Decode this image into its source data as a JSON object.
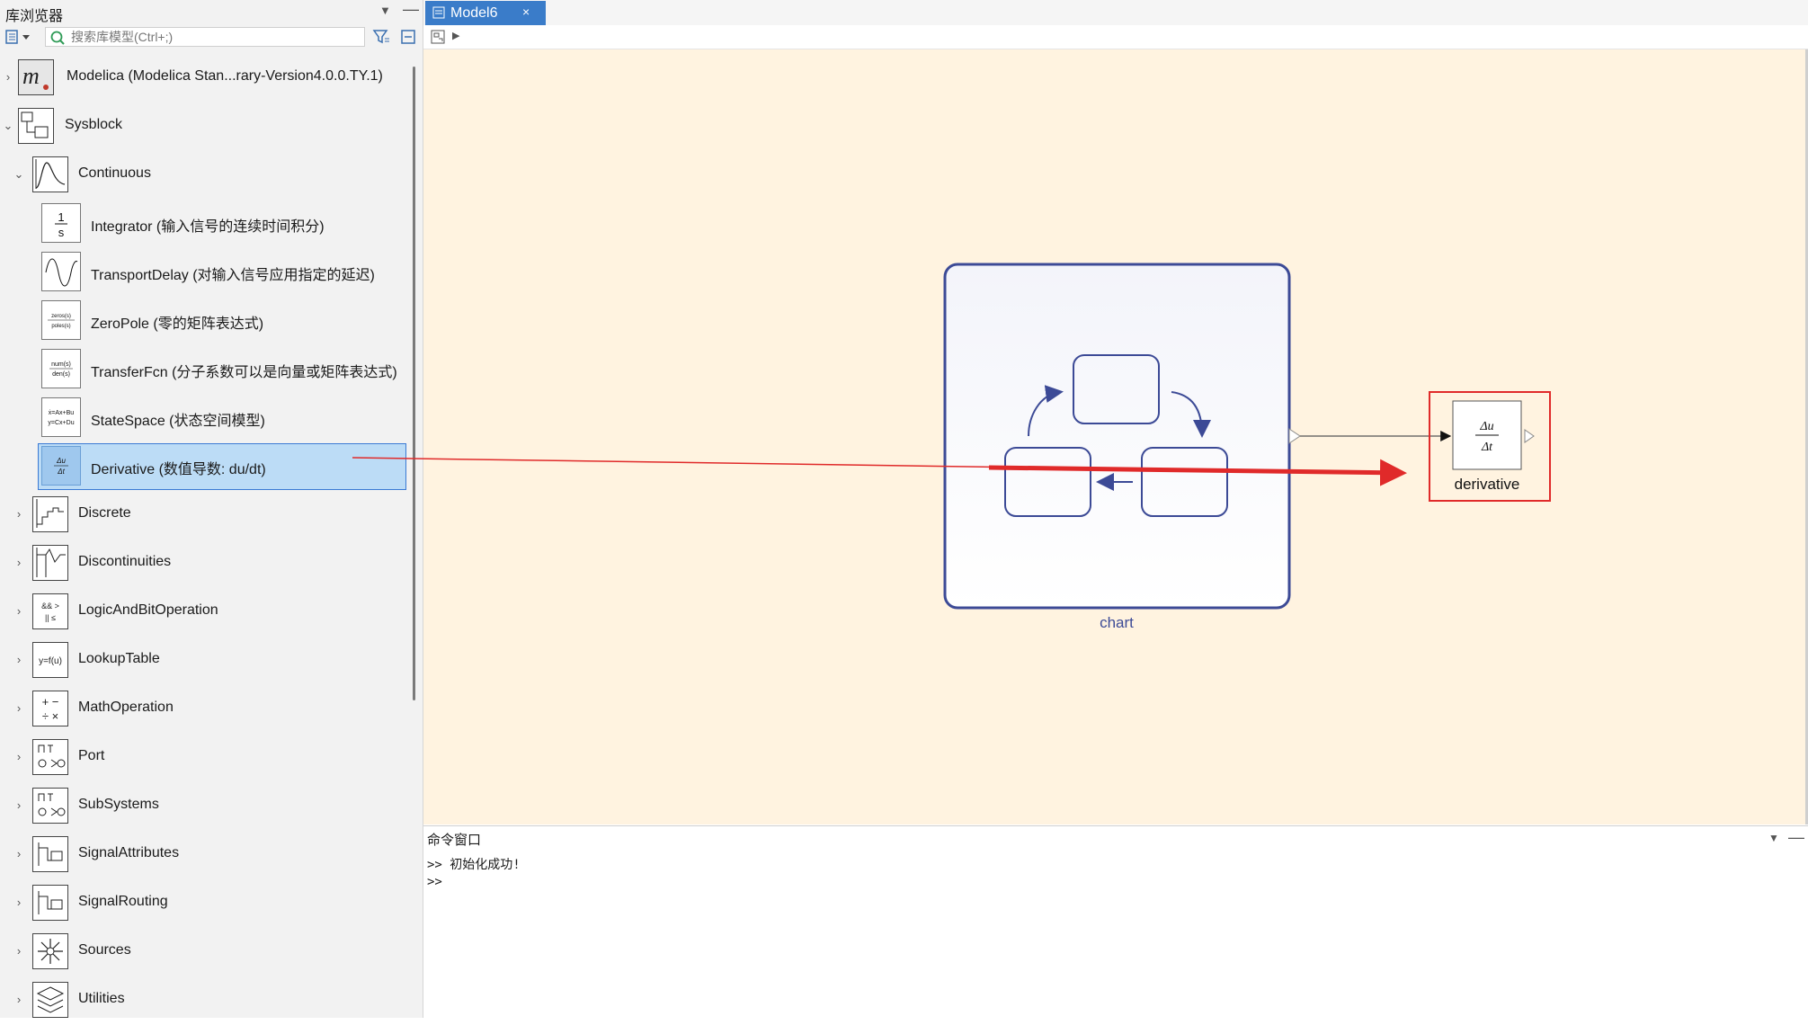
{
  "library_browser": {
    "title": "库浏览器",
    "search_placeholder": "搜索库模型(Ctrl+;)",
    "items": [
      {
        "label": "Modelica (Modelica Stan...rary-Version4.0.0.TY.1)",
        "expanded": false,
        "level": 0,
        "icon": "modelica-logo-icon"
      },
      {
        "label": "Sysblock",
        "expanded": true,
        "level": 0,
        "icon": "sysblock-icon"
      },
      {
        "label": "Continuous",
        "expanded": true,
        "level": 1,
        "icon": "continuous-icon"
      },
      {
        "label": "Integrator (输入信号的连续时间积分)",
        "level": 2,
        "icon": "integrator-icon"
      },
      {
        "label": "TransportDelay (对输入信号应用指定的延迟)",
        "level": 2,
        "icon": "transport-delay-icon"
      },
      {
        "label": "ZeroPole (零的矩阵表达式)",
        "level": 2,
        "icon": "zero-pole-icon"
      },
      {
        "label": "TransferFcn (分子系数可以是向量或矩阵表达式)",
        "level": 2,
        "icon": "transfer-fcn-icon"
      },
      {
        "label": "StateSpace (状态空间模型)",
        "level": 2,
        "icon": "state-space-icon"
      },
      {
        "label": "Derivative (数值导数: du/dt)",
        "level": 2,
        "icon": "derivative-icon",
        "selected": true
      },
      {
        "label": "Discrete",
        "expanded": false,
        "level": 1,
        "icon": "discrete-icon"
      },
      {
        "label": "Discontinuities",
        "expanded": false,
        "level": 1,
        "icon": "discontinuities-icon"
      },
      {
        "label": "LogicAndBitOperation",
        "expanded": false,
        "level": 1,
        "icon": "logic-icon"
      },
      {
        "label": "LookupTable",
        "expanded": false,
        "level": 1,
        "icon": "lookup-table-icon"
      },
      {
        "label": "MathOperation",
        "expanded": false,
        "level": 1,
        "icon": "math-operation-icon"
      },
      {
        "label": "Port",
        "expanded": false,
        "level": 1,
        "icon": "port-icon"
      },
      {
        "label": "SubSystems",
        "expanded": false,
        "level": 1,
        "icon": "subsystems-icon"
      },
      {
        "label": "SignalAttributes",
        "expanded": false,
        "level": 1,
        "icon": "signal-attributes-icon"
      },
      {
        "label": "SignalRouting",
        "expanded": false,
        "level": 1,
        "icon": "signal-routing-icon"
      },
      {
        "label": "Sources",
        "expanded": false,
        "level": 1,
        "icon": "sources-icon"
      },
      {
        "label": "Utilities",
        "expanded": false,
        "level": 1,
        "icon": "utilities-icon"
      }
    ],
    "icon_text": {
      "integrator_num": "1",
      "integrator_den": "s",
      "zeropole_num": "zeros(s)",
      "zeropole_den": "poles(s)",
      "tf_num": "num(s)",
      "tf_den": "den(s)",
      "ss_line1": "ẋ=Ax+Bu",
      "ss_line2": "y=Cx+Du",
      "deriv_num": "Δu",
      "deriv_den": "Δt",
      "logic_line1": "&& >",
      "logic_line2": "|| ≤",
      "lookup": "y=f(u)",
      "math_line1": "+ −",
      "math_line2": "÷ ×"
    }
  },
  "editor": {
    "tab_label": "Model6",
    "tab_close": "×"
  },
  "canvas": {
    "background": "#fff3e0",
    "chart_block_label": "chart",
    "derivative_block_label": "derivative",
    "derivative_num": "Δu",
    "derivative_den": "Δt",
    "block_color": "#3c4a96",
    "highlight_color": "#e02a2a"
  },
  "command_window": {
    "title": "命令窗口",
    "lines": [
      ">> 初始化成功!",
      ">>"
    ]
  }
}
